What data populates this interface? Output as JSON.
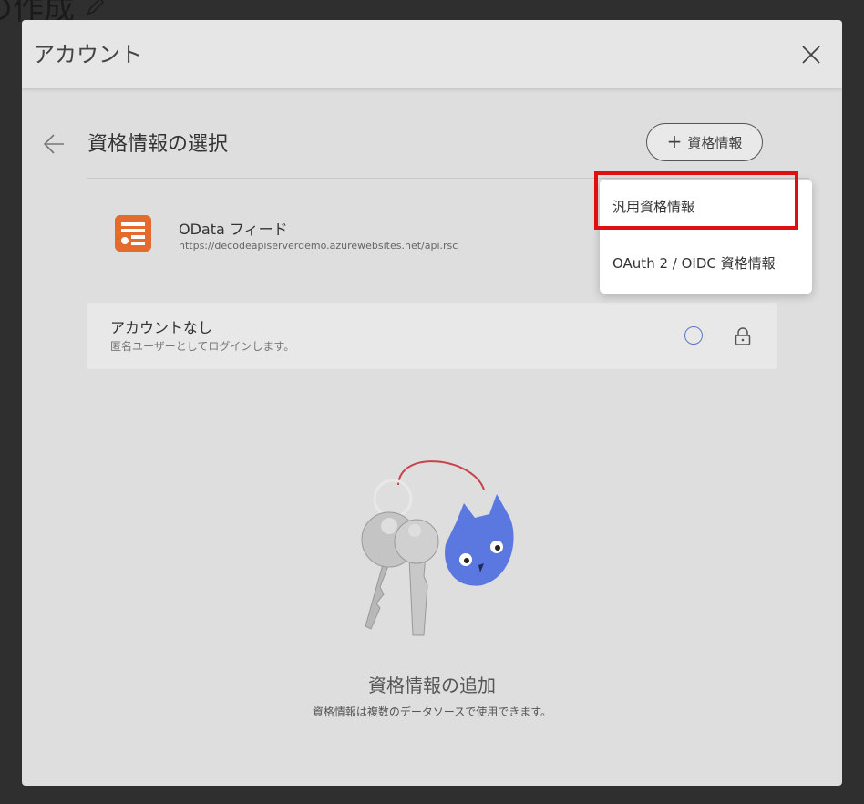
{
  "background": {
    "title": "の作成"
  },
  "dialog": {
    "title": "アカウント",
    "section_title": "資格情報の選択",
    "add_button_label": "資格情報",
    "source": {
      "name": "OData フィード",
      "url": "https://decodeapiserverdemo.azurewebsites.net/api.rsc"
    },
    "account_option": {
      "title": "アカウントなし",
      "subtitle": "匿名ユーザーとしてログインします。"
    },
    "empty_state": {
      "title": "資格情報の追加",
      "subtitle": "資格情報は複数のデータソースで使用できます。"
    }
  },
  "dropdown": {
    "items": [
      {
        "label": "汎用資格情報"
      },
      {
        "label": "OAuth 2 / OIDC 資格情報"
      }
    ]
  },
  "colors": {
    "highlight": "#e01010",
    "source_icon": "#e36b2e",
    "radio": "#5b78c7",
    "cat": "#5b78e0"
  },
  "icons": {
    "close": "close-icon",
    "back": "arrow-left-icon",
    "add": "plus-icon",
    "lock": "lock-icon",
    "edit": "pencil-icon",
    "source": "odata-feed-icon"
  }
}
